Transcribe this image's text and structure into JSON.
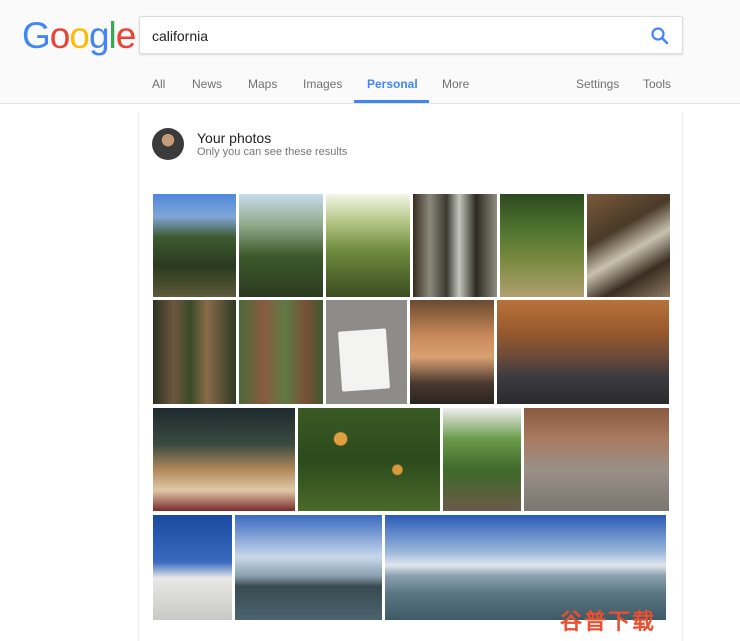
{
  "logo": {
    "letters": [
      "G",
      "o",
      "o",
      "g",
      "l",
      "e"
    ],
    "colors": [
      "#4285f4",
      "#ea4335",
      "#fbbc05",
      "#4285f4",
      "#34a853",
      "#ea4335"
    ]
  },
  "search": {
    "value": "california",
    "icon": "search-icon",
    "icon_color": "#4285f4"
  },
  "tabs": [
    {
      "label": "All",
      "active": false
    },
    {
      "label": "News",
      "active": false
    },
    {
      "label": "Maps",
      "active": false
    },
    {
      "label": "Images",
      "active": false
    },
    {
      "label": "Personal",
      "active": true
    },
    {
      "label": "More",
      "active": false
    },
    {
      "label": "Settings",
      "active": false
    },
    {
      "label": "Tools",
      "active": false
    }
  ],
  "accent_color": "#4285f4",
  "your_photos": {
    "title": "Your photos",
    "subtitle": "Only you can see these results",
    "avatar": "user-avatar",
    "photos": [
      {
        "name": "redwood-forest-photo-1",
        "subject": "redwood forest looking up"
      },
      {
        "name": "redwood-forest-photo-2",
        "subject": "redwood forest looking up"
      },
      {
        "name": "redwood-forest-photo-3",
        "subject": "sunlit redwood canopy"
      },
      {
        "name": "redwood-forest-photo-4",
        "subject": "redwood trunks"
      },
      {
        "name": "forest-trail-photo",
        "subject": "forest trail"
      },
      {
        "name": "person-hanging-tree-photo",
        "subject": "person hanging from fallen tree"
      },
      {
        "name": "redwood-trunks-photo-1",
        "subject": "redwood trunks"
      },
      {
        "name": "redwood-trunks-photo-2",
        "subject": "redwood trunks"
      },
      {
        "name": "white-card-photo",
        "subject": "white card"
      },
      {
        "name": "man-with-device-photo",
        "subject": "man holding device"
      },
      {
        "name": "lab-workbench-photo",
        "subject": "people at workbench"
      },
      {
        "name": "menorah-window-photo",
        "subject": "menorah by window"
      },
      {
        "name": "orange-tree-photo",
        "subject": "orange tree"
      },
      {
        "name": "lemon-tree-photo",
        "subject": "lemon tree"
      },
      {
        "name": "patio-grill-photo",
        "subject": "patio with grill"
      },
      {
        "name": "flags-building-photo",
        "subject": "flags by building"
      },
      {
        "name": "bay-pier-photo",
        "subject": "bay and pier"
      },
      {
        "name": "bay-panorama-photo",
        "subject": "bay panorama"
      }
    ]
  },
  "watermark": "谷普下载"
}
